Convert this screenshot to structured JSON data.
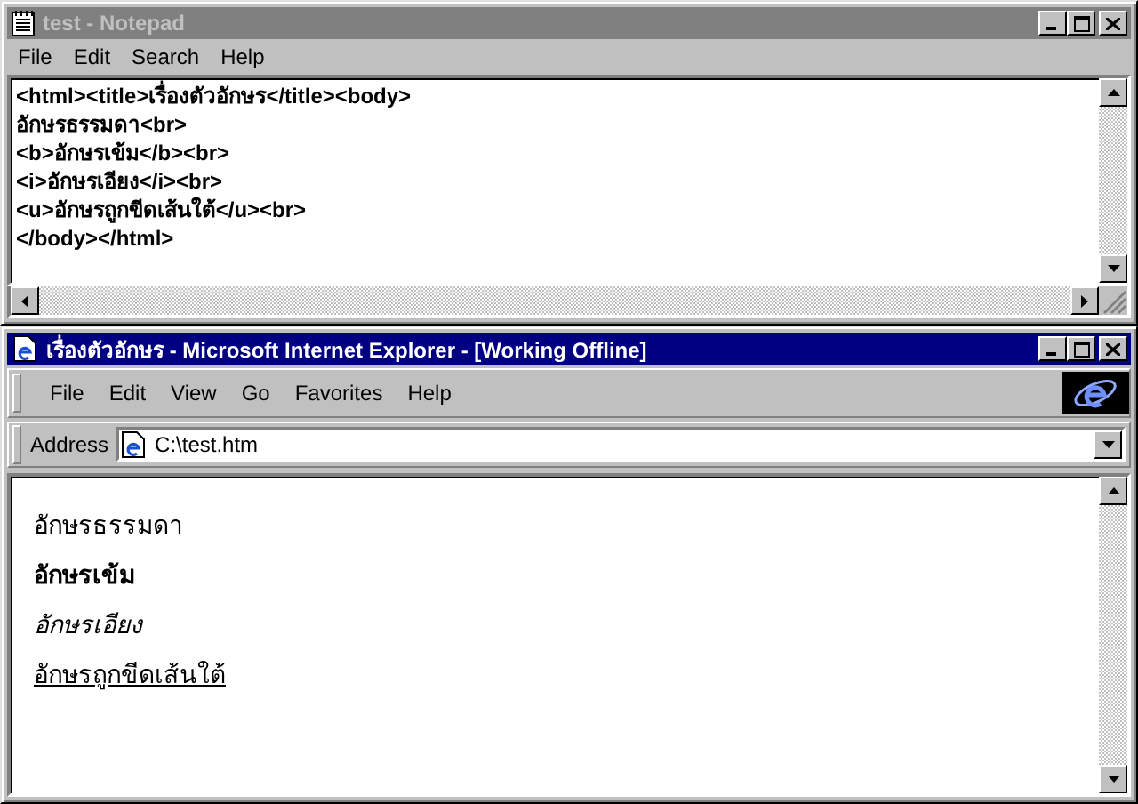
{
  "notepad": {
    "title": "test - Notepad",
    "active": false,
    "menu": [
      "File",
      "Edit",
      "Search",
      "Help"
    ],
    "lines": [
      "<html><title>เรื่องตัวอักษร</title><body>",
      "อักษรธรรมดา<br>",
      "<b>อักษรเข้ม</b><br>",
      "<i>อักษรเอียง</i><br>",
      "<u>อักษรถูกขีดเส้นใต้</u><br>",
      "</body></html>"
    ]
  },
  "browser": {
    "title": "เรื่องตัวอักษร - Microsoft Internet Explorer - [Working Offline]",
    "active": true,
    "menu": [
      "File",
      "Edit",
      "View",
      "Go",
      "Favorites",
      "Help"
    ],
    "address_label": "Address",
    "address": "C:\\test.htm",
    "content": [
      {
        "text": "อักษรธรรมดา",
        "kind": "normal"
      },
      {
        "text": "อักษรเข้ม",
        "kind": "bold"
      },
      {
        "text": "อักษรเอียง",
        "kind": "italic"
      },
      {
        "text": "อักษรถูกขีดเส้นใต้",
        "kind": "underline"
      }
    ]
  }
}
